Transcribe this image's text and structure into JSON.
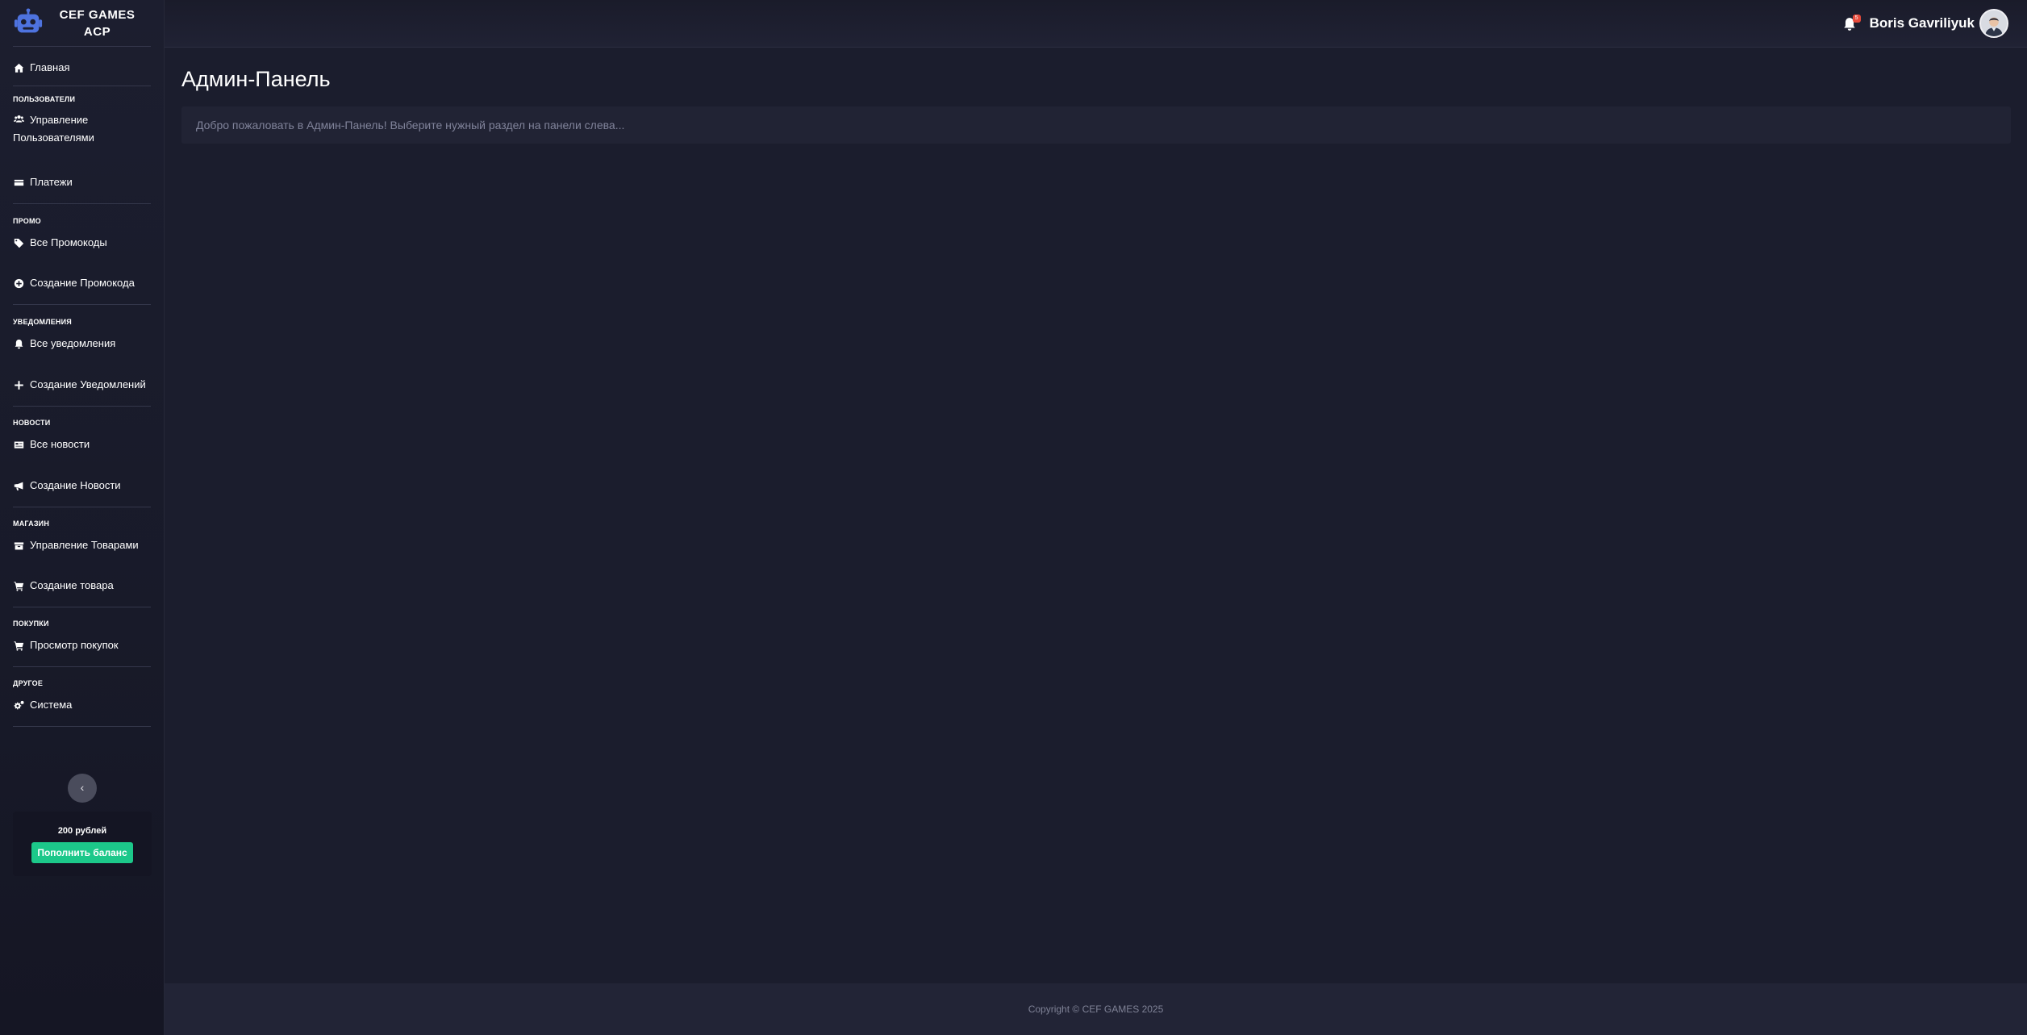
{
  "brand": {
    "line1": "CEF GAMES",
    "line2": "ACP",
    "logo_icon": "robot-icon",
    "logo_color": "#4e73df"
  },
  "sidebar": {
    "home": {
      "label": "Главная",
      "icon": "home-icon"
    },
    "sections": [
      {
        "title": "ПОЛЬЗОВАТЕЛИ",
        "items": [
          {
            "label": "Управление Пользователями",
            "icon": "users-icon"
          },
          {
            "label": "Платежи",
            "icon": "credit-card-icon"
          }
        ]
      },
      {
        "title": "ПРОМО",
        "items": [
          {
            "label": "Все Промокоды",
            "icon": "tag-icon"
          },
          {
            "label": "Создание Промокода",
            "icon": "plus-circle-icon"
          }
        ]
      },
      {
        "title": "УВЕДОМЛЕНИЯ",
        "items": [
          {
            "label": "Все уведомления",
            "icon": "bell-icon"
          },
          {
            "label": "Создание Уведомлений",
            "icon": "plus-icon"
          }
        ]
      },
      {
        "title": "НОВОСТИ",
        "items": [
          {
            "label": "Все новости",
            "icon": "newspaper-icon"
          },
          {
            "label": "Создание Новости",
            "icon": "bullhorn-icon"
          }
        ]
      },
      {
        "title": "МАГАЗИН",
        "items": [
          {
            "label": "Управление Товарами",
            "icon": "box-icon"
          },
          {
            "label": "Создание товара",
            "icon": "cart-plus-icon"
          }
        ]
      },
      {
        "title": "ПОКУПКИ",
        "items": [
          {
            "label": "Просмотр покупок",
            "icon": "shopping-cart-icon"
          }
        ]
      },
      {
        "title": "ДРУГОЕ",
        "items": [
          {
            "label": "Система",
            "icon": "cogs-icon"
          }
        ]
      }
    ],
    "collapse_icon": "chevron-left-icon",
    "balance": {
      "amount": "200 рублей",
      "button": "Пополнить баланс",
      "button_color": "#1cc88a"
    }
  },
  "topbar": {
    "notifications_icon": "bell-icon",
    "notifications_count": "5",
    "badge_color": "#e74a3b",
    "username": "Boris Gavriliyuk",
    "avatar_icon": "user-avatar-icon"
  },
  "main": {
    "title": "Админ-Панель",
    "welcome": "Добро пожаловать в Админ-Панель! Выберите нужный раздел на панели слева..."
  },
  "footer": {
    "copyright": "Copyright © CEF GAMES 2025"
  }
}
